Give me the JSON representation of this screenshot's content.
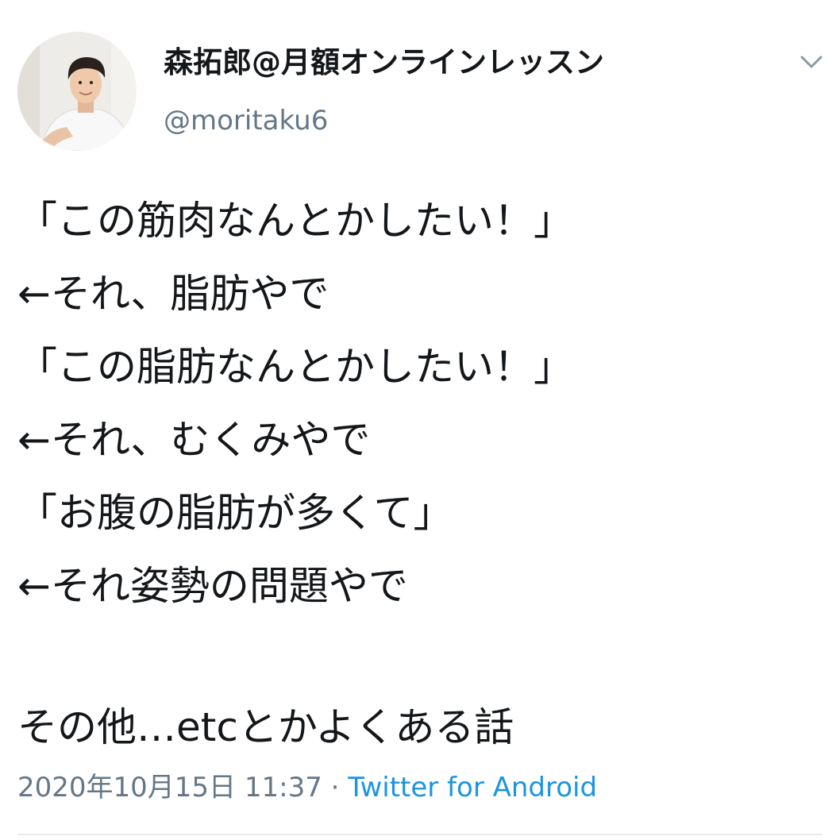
{
  "author": {
    "display_name": "森拓郎@月額オンラインレッスン",
    "handle": "@moritaku6",
    "avatar_icon": "profile-photo"
  },
  "menu": {
    "icon": "chevron-down-icon"
  },
  "tweet": {
    "lines": [
      "「この筋肉なんとかしたい！」",
      "←それ、脂肪やで",
      "「この脂肪なんとかしたい！」",
      "←それ、むくみやで",
      "「お腹の脂肪が多くて」",
      "←それ姿勢の問題やで",
      "",
      "その他…etcとかよくある話"
    ]
  },
  "meta": {
    "timestamp": "2020年10月15日 11:37",
    "separator": " · ",
    "source": "Twitter for Android"
  },
  "colors": {
    "text": "#14171a",
    "secondary": "#657786",
    "link": "#1b95e0",
    "divider": "#e6ecf0"
  }
}
